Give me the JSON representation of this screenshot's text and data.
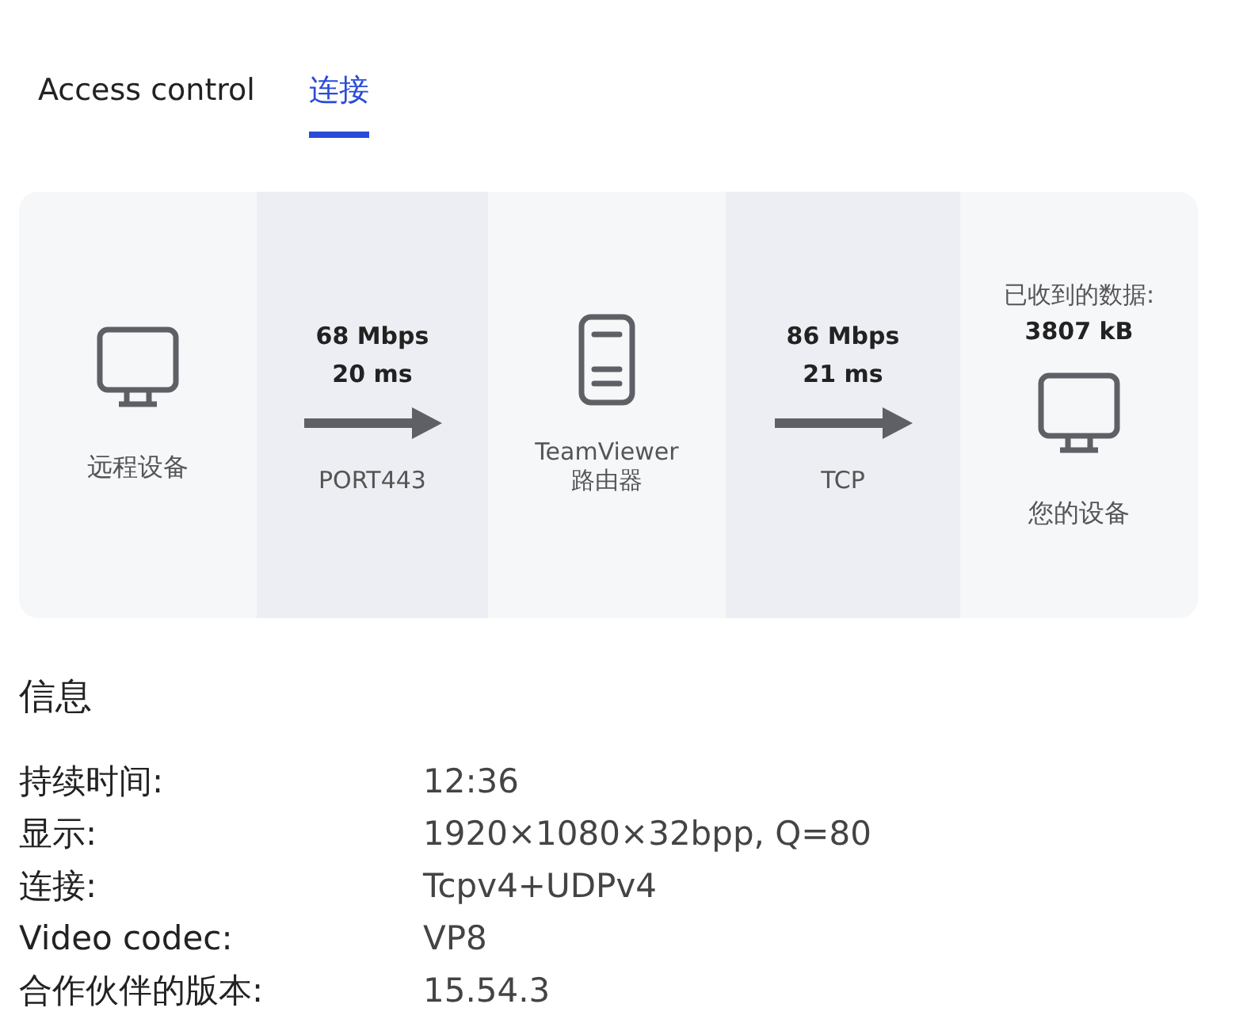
{
  "tabs": [
    {
      "label": "Access control",
      "selected": false
    },
    {
      "label": "连接",
      "selected": true
    }
  ],
  "path": [
    {
      "kind": "device",
      "label": "远程设备"
    },
    {
      "kind": "link",
      "speed": "68 Mbps",
      "latency": "20 ms",
      "protocol": "PORT443"
    },
    {
      "kind": "router",
      "label": "TeamViewer 路由器"
    },
    {
      "kind": "link",
      "speed": "86 Mbps",
      "latency": "21 ms",
      "protocol": "TCP"
    },
    {
      "kind": "device",
      "caption": "已收到的数据:",
      "amount": "3807 kB",
      "label": "您的设备"
    }
  ],
  "info": {
    "title": "信息",
    "rows": [
      {
        "label": "持续时间:",
        "value": "12:36"
      },
      {
        "label": "显示:",
        "value": "1920×1080×32bpp, Q=80"
      },
      {
        "label": "连接:",
        "value": "Tcpv4+UDPv4"
      },
      {
        "label": "Video codec:",
        "value": "VP8"
      },
      {
        "label": "合作伙伴的版本:",
        "value": "15.54.3"
      }
    ]
  }
}
